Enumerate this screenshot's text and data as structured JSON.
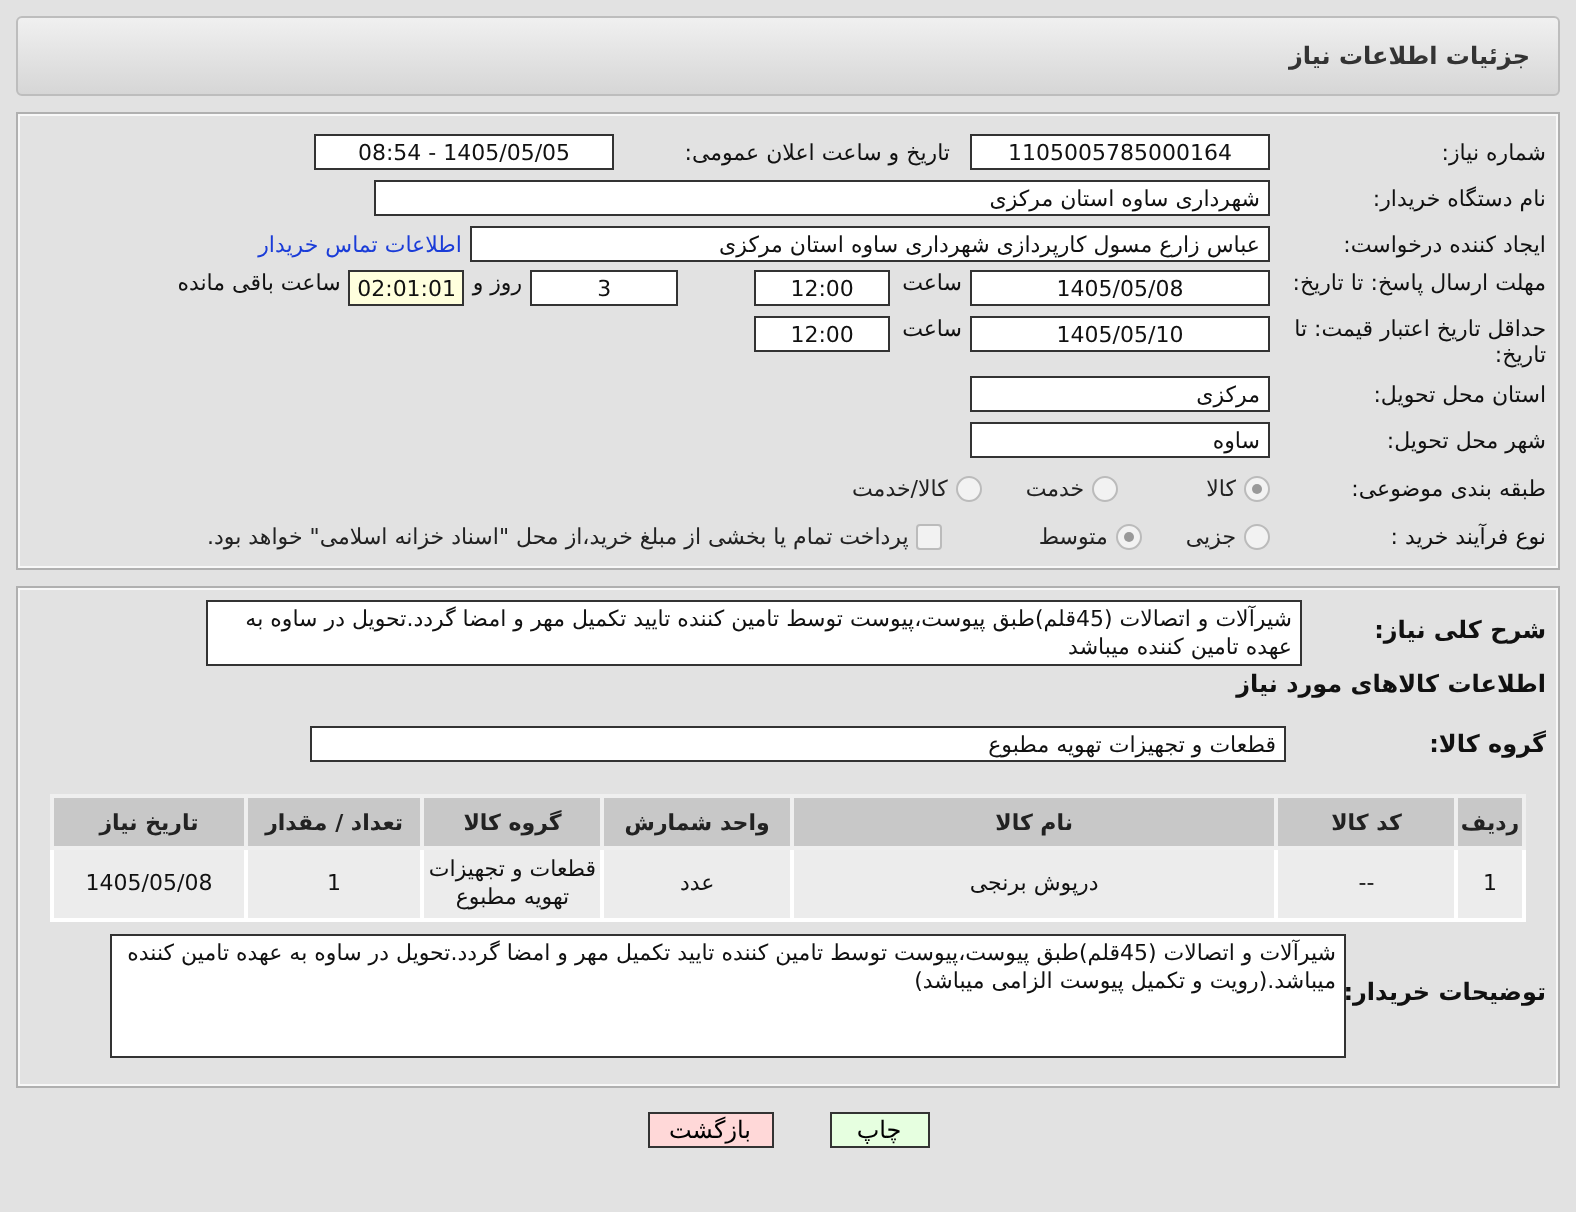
{
  "header": {
    "title": "جزئیات اطلاعات نیاز"
  },
  "need_number": {
    "label": "شماره نیاز:",
    "value": "1105005785000164"
  },
  "announce_datetime": {
    "label": "تاریخ و ساعت اعلان عمومی:",
    "value": "1405/05/05 - 08:54"
  },
  "buyer_org": {
    "label": "نام دستگاه خریدار:",
    "value": "شهرداری ساوه استان مرکزی"
  },
  "requester": {
    "label": "ایجاد کننده درخواست:",
    "value": "عباس زارع مسول کارپردازی شهرداری ساوه استان مرکزی",
    "link": "اطلاعات تماس خریدار"
  },
  "reply_deadline": {
    "label": "مهلت ارسال پاسخ: تا تاریخ:",
    "date": "1405/05/08",
    "time_label": "ساعت",
    "time": "12:00",
    "days": "3",
    "days_label": "روز و",
    "remaining": "02:01:01",
    "remaining_label": "ساعت باقی مانده"
  },
  "price_validity": {
    "label": "حداقل تاریخ اعتبار قیمت: تا تاریخ:",
    "date": "1405/05/10",
    "time_label": "ساعت",
    "time": "12:00"
  },
  "delivery_province": {
    "label": "استان محل تحویل:",
    "value": "مرکزی"
  },
  "delivery_city": {
    "label": "شهر محل تحویل:",
    "value": "ساوه"
  },
  "category": {
    "label": "طبقه بندی موضوعی:",
    "options": [
      {
        "label": "کالا",
        "selected": true
      },
      {
        "label": "خدمت",
        "selected": false
      },
      {
        "label": "کالا/خدمت",
        "selected": false
      }
    ]
  },
  "purchase_process": {
    "label": "نوع فرآیند خرید :",
    "options": [
      {
        "label": "جزیی",
        "selected": false
      },
      {
        "label": "متوسط",
        "selected": true
      }
    ],
    "payment_checkbox": {
      "label": "پرداخت تمام یا بخشی از مبلغ خرید،از محل \"اسناد خزانه اسلامی\" خواهد بود.",
      "checked": false
    }
  },
  "description": {
    "label": "شرح کلی نیاز:",
    "value": "شیرآلات و اتصالات (45قلم)طبق پیوست،پیوست توسط تامین کننده تایید تکمیل مهر و امضا گردد.تحویل در ساوه به عهده تامین کننده میباشد"
  },
  "goods_heading": "اطلاعات کالاهای مورد نیاز",
  "goods_group": {
    "label": "گروه کالا:",
    "value": "قطعات و تجهیزات تهویه مطبوع"
  },
  "table": {
    "columns": [
      "ردیف",
      "کد کالا",
      "نام کالا",
      "واحد شمارش",
      "گروه کالا",
      "تعداد / مقدار",
      "تاریخ نیاز"
    ],
    "rows": [
      [
        "1",
        "--",
        "درپوش برنجی",
        "عدد",
        "قطعات و تجهیزات تهویه مطبوع",
        "1",
        "1405/05/08"
      ]
    ]
  },
  "buyer_notes": {
    "label": "توضیحات خریدار:",
    "value": "شیرآلات و اتصالات (45قلم)طبق پیوست،پیوست توسط تامین کننده تایید تکمیل مهر و امضا گردد.تحویل در ساوه به عهده تامین کننده میباشد.(رویت و تکمیل پیوست الزامی میباشد)"
  },
  "buttons": [
    {
      "label": "چاپ",
      "kind": "print"
    },
    {
      "label": "بازگشت",
      "kind": "back"
    }
  ]
}
